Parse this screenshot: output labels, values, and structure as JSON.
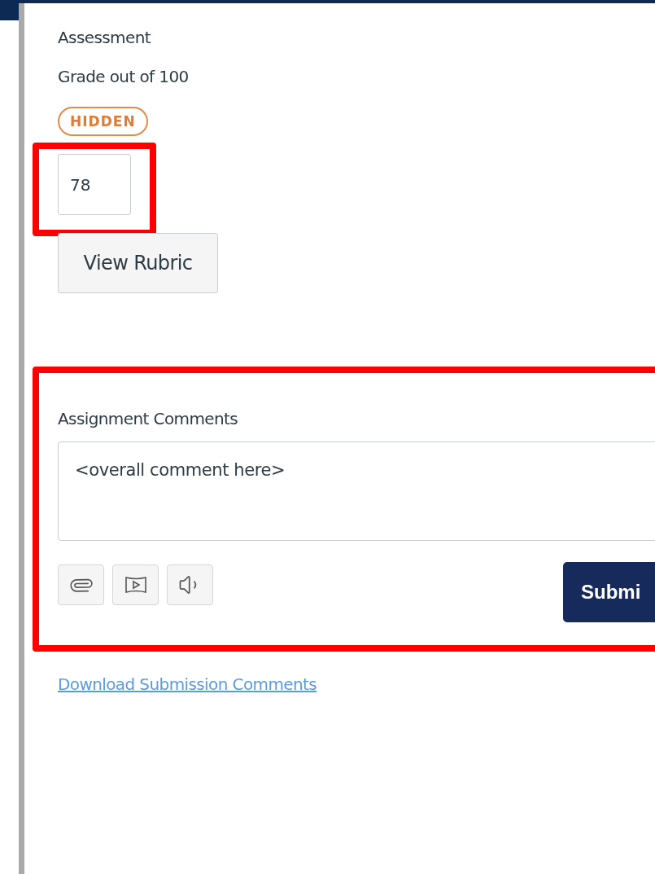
{
  "grading": {
    "title": "Assessment",
    "subtitle": "Grade out of 100",
    "status_badge": "HIDDEN",
    "grade": "78",
    "rubric_button": "View Rubric"
  },
  "comments": {
    "title": "Assignment Comments",
    "draft": "<overall comment here>",
    "tools": [
      {
        "kind": "attach"
      },
      {
        "kind": "media"
      },
      {
        "kind": "audio"
      }
    ],
    "submit_button": "Submi"
  },
  "download_link": "Download Submission Comments"
}
